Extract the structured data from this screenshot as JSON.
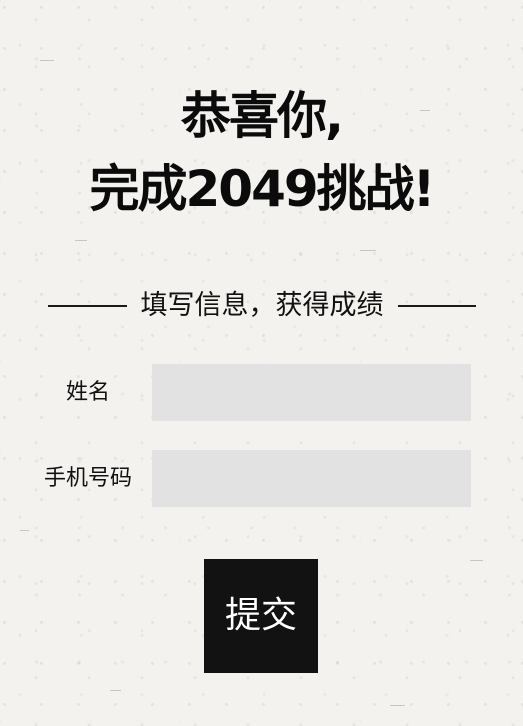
{
  "headline": {
    "line1": "恭喜你,",
    "line2": "完成2049挑战!"
  },
  "section": {
    "divider_text": "填写信息，获得成绩"
  },
  "form": {
    "name_label": "姓名",
    "name_value": "",
    "phone_label": "手机号码",
    "phone_value": "",
    "submit_label": "提交"
  },
  "colors": {
    "background": "#f3f2ef",
    "text": "#111111",
    "input_background": "#e2e2e2",
    "button_background": "#121212",
    "button_text": "#ffffff"
  }
}
